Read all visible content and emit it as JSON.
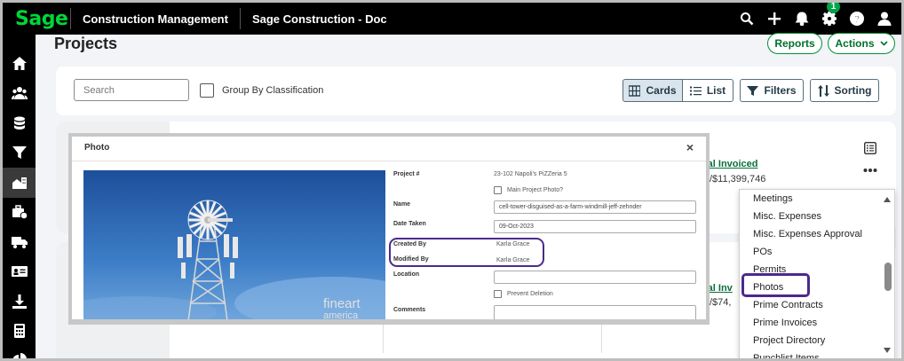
{
  "topbar": {
    "logo": "Sage",
    "app_name": "Construction Management",
    "company": "Sage Construction - Doc",
    "notification_count": "1"
  },
  "page": {
    "title": "Projects",
    "reports_label": "Reports",
    "actions_label": "Actions"
  },
  "filters": {
    "search_placeholder": "Search",
    "group_by_label": "Group By Classification",
    "cards_label": "Cards",
    "list_label": "List",
    "filters_label": "Filters",
    "sorting_label": "Sorting"
  },
  "cards": [
    {
      "invoiced_label": "tal Invoiced",
      "invoiced_value": "/$11,399,746"
    },
    {
      "invoiced_label": "tal Inv",
      "invoiced_value": "/$74,"
    }
  ],
  "dropdown": {
    "items": [
      "Meetings",
      "Misc. Expenses",
      "Misc. Expenses Approval",
      "POs",
      "Permits",
      "Photos",
      "Prime Contracts",
      "Prime Invoices",
      "Project Directory",
      "Punchlist Items"
    ],
    "highlighted": "Photos"
  },
  "photo_modal": {
    "title": "Photo",
    "close": "×",
    "watermark_line1": "fineart",
    "watermark_line2": "america",
    "project_label": "Project #",
    "project_value": "23-102   Napoli's PiZZeria 5",
    "main_photo_label": "Main Project Photo?",
    "name_label": "Name",
    "name_value": "cell-tower-disguised-as-a-farm-windmill-jeff-zehnder",
    "date_label": "Date Taken",
    "date_value": "09-Oct-2023",
    "created_label": "Created By",
    "created_value": "Karla Grace",
    "modified_label": "Modified By",
    "modified_value": "Karla Grace",
    "location_label": "Location",
    "location_value": "",
    "prevent_deletion_label": "Prevent Deletion",
    "comments_label": "Comments"
  },
  "colors": {
    "brand_green": "#00d639",
    "button_green": "#00913c",
    "annotation_purple": "#4b2a8c"
  }
}
